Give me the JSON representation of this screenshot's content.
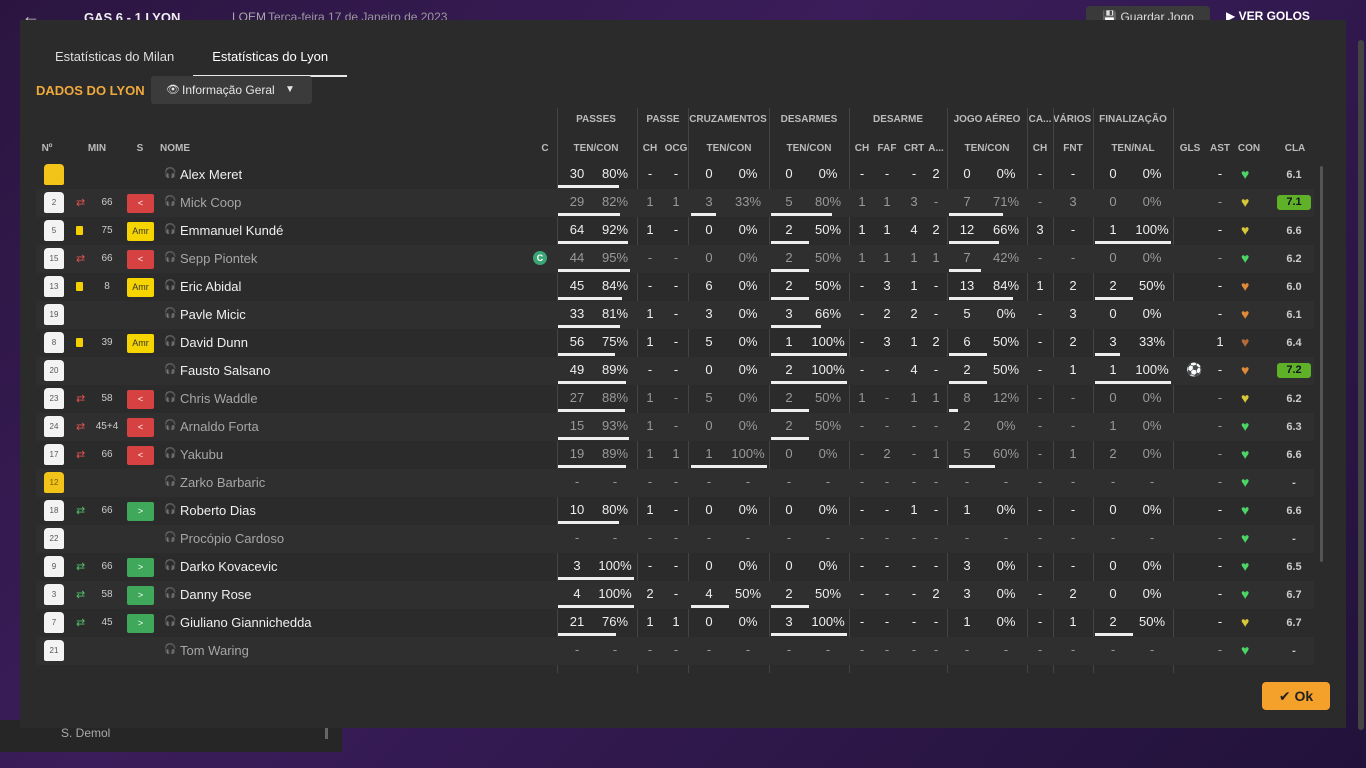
{
  "background": {
    "back_icon": "arrow-left-icon",
    "match_title": "GAS   6 - 1  LYON",
    "competition": "LOEM",
    "date": "Terça-feira 17 de Janeiro de 2023",
    "save_label": "Guardar Jogo",
    "play_label": "VER GOLOS",
    "bottom_player": "S. Demol"
  },
  "tabs": [
    {
      "label": "Estatísticas do Milan",
      "active": false
    },
    {
      "label": "Estatísticas do Lyon",
      "active": true
    }
  ],
  "section_title": "DADOS DO LYON",
  "view_selector": {
    "label": "Informação Geral",
    "icon": "eye-icon"
  },
  "group_headers": {
    "passes": "PASSES",
    "passe": "PASSE",
    "cruzamentos": "CRUZAMENTOS",
    "desarmes": "DESARMES",
    "desarme": "DESARME",
    "jogo_aereo": "JOGO AÉREO",
    "ca": "CA...",
    "varios": "VÁRIOS",
    "finalizacao": "FINALIZAÇÃO"
  },
  "columns": {
    "no": "Nº",
    "min": "MIN",
    "s": "S",
    "nome": "NOME",
    "c": "C",
    "passes_tc": "TEN/CON",
    "passe_ch": "CH",
    "passe_ocg": "OCG",
    "cruz_tc": "TEN/CON",
    "des_tc": "TEN/CON",
    "des_ch": "CH",
    "des_faf": "FAF",
    "des_crt": "CRT",
    "des_a": "A...",
    "aereo_tc": "TEN/CON",
    "ca_ch": "CH",
    "varios_fnt": "FNT",
    "fin_tn": "TEN/NAL",
    "gls": "GLS",
    "ast": "AST",
    "con": "CON",
    "cla": "CLA"
  },
  "players": [
    {
      "no": "",
      "gk": true,
      "sub": "",
      "min": "",
      "badge": "",
      "name": "Alex Meret",
      "dim": false,
      "captain": false,
      "pt": "30",
      "pp": "80%",
      "pbar": 80,
      "pch": "-",
      "pocg": "-",
      "ct": "0",
      "cp": "0%",
      "cbar": 0,
      "dt": "0",
      "dp": "0%",
      "dbar": 0,
      "dch": "-",
      "dfaf": "-",
      "dcrt": "-",
      "da": "2",
      "at": "0",
      "ap": "0%",
      "abar": 0,
      "cach": "-",
      "fnt": "-",
      "ft": "0",
      "fp": "0%",
      "fbar": 0,
      "gls": "",
      "ast": "-",
      "con": "green",
      "cla": "6.1",
      "best": false
    },
    {
      "no": "2",
      "gk": false,
      "sub": "out",
      "min": "66",
      "badge": "out",
      "name": "Mick Coop",
      "dim": true,
      "captain": false,
      "pt": "29",
      "pp": "82%",
      "pbar": 82,
      "pch": "1",
      "pocg": "1",
      "ct": "3",
      "cp": "33%",
      "cbar": 33,
      "dt": "5",
      "dp": "80%",
      "dbar": 80,
      "dch": "1",
      "dfaf": "1",
      "dcrt": "3",
      "da": "-",
      "at": "7",
      "ap": "71%",
      "abar": 71,
      "cach": "-",
      "fnt": "3",
      "ft": "0",
      "fp": "0%",
      "fbar": 0,
      "gls": "",
      "ast": "-",
      "con": "yellow",
      "cla": "7.1",
      "best": true
    },
    {
      "no": "5",
      "gk": false,
      "sub": "card",
      "min": "75",
      "badge": "amr",
      "name": "Emmanuel Kundé",
      "dim": false,
      "captain": false,
      "pt": "64",
      "pp": "92%",
      "pbar": 92,
      "pch": "1",
      "pocg": "-",
      "ct": "0",
      "cp": "0%",
      "cbar": 0,
      "dt": "2",
      "dp": "50%",
      "dbar": 50,
      "dch": "1",
      "dfaf": "1",
      "dcrt": "4",
      "da": "2",
      "at": "12",
      "ap": "66%",
      "abar": 66,
      "cach": "3",
      "fnt": "-",
      "ft": "1",
      "fp": "100%",
      "fbar": 100,
      "gls": "",
      "ast": "-",
      "con": "yellow",
      "cla": "6.6",
      "best": false
    },
    {
      "no": "15",
      "gk": false,
      "sub": "out",
      "min": "66",
      "badge": "out",
      "name": "Sepp Piontek",
      "dim": true,
      "captain": true,
      "pt": "44",
      "pp": "95%",
      "pbar": 95,
      "pch": "-",
      "pocg": "-",
      "ct": "0",
      "cp": "0%",
      "cbar": 0,
      "dt": "2",
      "dp": "50%",
      "dbar": 50,
      "dch": "1",
      "dfaf": "1",
      "dcrt": "1",
      "da": "1",
      "at": "7",
      "ap": "42%",
      "abar": 42,
      "cach": "-",
      "fnt": "-",
      "ft": "0",
      "fp": "0%",
      "fbar": 0,
      "gls": "",
      "ast": "-",
      "con": "green",
      "cla": "6.2",
      "best": false
    },
    {
      "no": "13",
      "gk": false,
      "sub": "card",
      "min": "8",
      "badge": "amr",
      "name": "Eric Abidal",
      "dim": false,
      "captain": false,
      "pt": "45",
      "pp": "84%",
      "pbar": 84,
      "pch": "-",
      "pocg": "-",
      "ct": "6",
      "cp": "0%",
      "cbar": 0,
      "dt": "2",
      "dp": "50%",
      "dbar": 50,
      "dch": "-",
      "dfaf": "3",
      "dcrt": "1",
      "da": "-",
      "at": "13",
      "ap": "84%",
      "abar": 84,
      "cach": "1",
      "fnt": "2",
      "ft": "2",
      "fp": "50%",
      "fbar": 50,
      "gls": "",
      "ast": "-",
      "con": "orange",
      "cla": "6.0",
      "best": false
    },
    {
      "no": "19",
      "gk": false,
      "sub": "",
      "min": "",
      "badge": "",
      "name": "Pavle Micic",
      "dim": false,
      "captain": false,
      "pt": "33",
      "pp": "81%",
      "pbar": 81,
      "pch": "1",
      "pocg": "-",
      "ct": "3",
      "cp": "0%",
      "cbar": 0,
      "dt": "3",
      "dp": "66%",
      "dbar": 66,
      "dch": "-",
      "dfaf": "2",
      "dcrt": "2",
      "da": "-",
      "at": "5",
      "ap": "0%",
      "abar": 0,
      "cach": "-",
      "fnt": "3",
      "ft": "0",
      "fp": "0%",
      "fbar": 0,
      "gls": "",
      "ast": "-",
      "con": "orange",
      "cla": "6.1",
      "best": false
    },
    {
      "no": "8",
      "gk": false,
      "sub": "card",
      "min": "39",
      "badge": "amr",
      "name": "David Dunn",
      "dim": false,
      "captain": false,
      "pt": "56",
      "pp": "75%",
      "pbar": 75,
      "pch": "1",
      "pocg": "-",
      "ct": "5",
      "cp": "0%",
      "cbar": 0,
      "dt": "1",
      "dp": "100%",
      "dbar": 100,
      "dch": "-",
      "dfaf": "3",
      "dcrt": "1",
      "da": "2",
      "at": "6",
      "ap": "50%",
      "abar": 50,
      "cach": "-",
      "fnt": "2",
      "ft": "3",
      "fp": "33%",
      "fbar": 33,
      "gls": "",
      "ast": "1",
      "con": "brown",
      "cla": "6.4",
      "best": false
    },
    {
      "no": "20",
      "gk": false,
      "sub": "",
      "min": "",
      "badge": "",
      "name": "Fausto Salsano",
      "dim": false,
      "captain": false,
      "pt": "49",
      "pp": "89%",
      "pbar": 89,
      "pch": "-",
      "pocg": "-",
      "ct": "0",
      "cp": "0%",
      "cbar": 0,
      "dt": "2",
      "dp": "100%",
      "dbar": 100,
      "dch": "-",
      "dfaf": "-",
      "dcrt": "4",
      "da": "-",
      "at": "2",
      "ap": "50%",
      "abar": 50,
      "cach": "-",
      "fnt": "1",
      "ft": "1",
      "fp": "100%",
      "fbar": 100,
      "gls": "ball",
      "ast": "-",
      "con": "orange",
      "cla": "7.2",
      "best": true
    },
    {
      "no": "23",
      "gk": false,
      "sub": "out",
      "min": "58",
      "badge": "out",
      "name": "Chris Waddle",
      "dim": true,
      "captain": false,
      "pt": "27",
      "pp": "88%",
      "pbar": 88,
      "pch": "1",
      "pocg": "-",
      "ct": "5",
      "cp": "0%",
      "cbar": 0,
      "dt": "2",
      "dp": "50%",
      "dbar": 50,
      "dch": "1",
      "dfaf": "-",
      "dcrt": "1",
      "da": "1",
      "at": "8",
      "ap": "12%",
      "abar": 12,
      "cach": "-",
      "fnt": "-",
      "ft": "0",
      "fp": "0%",
      "fbar": 0,
      "gls": "",
      "ast": "-",
      "con": "yellow",
      "cla": "6.2",
      "best": false
    },
    {
      "no": "24",
      "gk": false,
      "sub": "out",
      "min": "45+4",
      "badge": "out",
      "name": "Arnaldo Forta",
      "dim": true,
      "captain": false,
      "pt": "15",
      "pp": "93%",
      "pbar": 93,
      "pch": "1",
      "pocg": "-",
      "ct": "0",
      "cp": "0%",
      "cbar": 0,
      "dt": "2",
      "dp": "50%",
      "dbar": 50,
      "dch": "-",
      "dfaf": "-",
      "dcrt": "-",
      "da": "-",
      "at": "2",
      "ap": "0%",
      "abar": 0,
      "cach": "-",
      "fnt": "-",
      "ft": "1",
      "fp": "0%",
      "fbar": 0,
      "gls": "",
      "ast": "-",
      "con": "green",
      "cla": "6.3",
      "best": false
    },
    {
      "no": "17",
      "gk": false,
      "sub": "out",
      "min": "66",
      "badge": "out",
      "name": "Yakubu",
      "dim": true,
      "captain": false,
      "pt": "19",
      "pp": "89%",
      "pbar": 89,
      "pch": "1",
      "pocg": "1",
      "ct": "1",
      "cp": "100%",
      "cbar": 100,
      "dt": "0",
      "dp": "0%",
      "dbar": 0,
      "dch": "-",
      "dfaf": "2",
      "dcrt": "-",
      "da": "1",
      "at": "5",
      "ap": "60%",
      "abar": 60,
      "cach": "-",
      "fnt": "1",
      "ft": "2",
      "fp": "0%",
      "fbar": 0,
      "gls": "",
      "ast": "-",
      "con": "green",
      "cla": "6.6",
      "best": false
    },
    {
      "no": "12",
      "gk": true,
      "sub": "",
      "min": "",
      "badge": "",
      "name": "Zarko Barbaric",
      "dim": true,
      "captain": false,
      "pt": "-",
      "pp": "-",
      "pbar": 0,
      "pch": "-",
      "pocg": "-",
      "ct": "-",
      "cp": "-",
      "cbar": 0,
      "dt": "-",
      "dp": "-",
      "dbar": 0,
      "dch": "-",
      "dfaf": "-",
      "dcrt": "-",
      "da": "-",
      "at": "-",
      "ap": "-",
      "abar": 0,
      "cach": "-",
      "fnt": "-",
      "ft": "-",
      "fp": "-",
      "fbar": 0,
      "gls": "",
      "ast": "-",
      "con": "green",
      "cla": "-",
      "best": false
    },
    {
      "no": "18",
      "gk": false,
      "sub": "in",
      "min": "66",
      "badge": "in",
      "name": "Roberto Dias",
      "dim": false,
      "captain": false,
      "pt": "10",
      "pp": "80%",
      "pbar": 80,
      "pch": "1",
      "pocg": "-",
      "ct": "0",
      "cp": "0%",
      "cbar": 0,
      "dt": "0",
      "dp": "0%",
      "dbar": 0,
      "dch": "-",
      "dfaf": "-",
      "dcrt": "1",
      "da": "-",
      "at": "1",
      "ap": "0%",
      "abar": 0,
      "cach": "-",
      "fnt": "-",
      "ft": "0",
      "fp": "0%",
      "fbar": 0,
      "gls": "",
      "ast": "-",
      "con": "green",
      "cla": "6.6",
      "best": false
    },
    {
      "no": "22",
      "gk": false,
      "sub": "",
      "min": "",
      "badge": "",
      "name": "Procópio Cardoso",
      "dim": true,
      "captain": false,
      "pt": "-",
      "pp": "-",
      "pbar": 0,
      "pch": "-",
      "pocg": "-",
      "ct": "-",
      "cp": "-",
      "cbar": 0,
      "dt": "-",
      "dp": "-",
      "dbar": 0,
      "dch": "-",
      "dfaf": "-",
      "dcrt": "-",
      "da": "-",
      "at": "-",
      "ap": "-",
      "abar": 0,
      "cach": "-",
      "fnt": "-",
      "ft": "-",
      "fp": "-",
      "fbar": 0,
      "gls": "",
      "ast": "-",
      "con": "green",
      "cla": "-",
      "best": false
    },
    {
      "no": "9",
      "gk": false,
      "sub": "in",
      "min": "66",
      "badge": "in",
      "name": "Darko Kovacevic",
      "dim": false,
      "captain": false,
      "pt": "3",
      "pp": "100%",
      "pbar": 100,
      "pch": "-",
      "pocg": "-",
      "ct": "0",
      "cp": "0%",
      "cbar": 0,
      "dt": "0",
      "dp": "0%",
      "dbar": 0,
      "dch": "-",
      "dfaf": "-",
      "dcrt": "-",
      "da": "-",
      "at": "3",
      "ap": "0%",
      "abar": 0,
      "cach": "-",
      "fnt": "-",
      "ft": "0",
      "fp": "0%",
      "fbar": 0,
      "gls": "",
      "ast": "-",
      "con": "green",
      "cla": "6.5",
      "best": false
    },
    {
      "no": "3",
      "gk": false,
      "sub": "in",
      "min": "58",
      "badge": "in",
      "name": "Danny Rose",
      "dim": false,
      "captain": false,
      "pt": "4",
      "pp": "100%",
      "pbar": 100,
      "pch": "2",
      "pocg": "-",
      "ct": "4",
      "cp": "50%",
      "cbar": 50,
      "dt": "2",
      "dp": "50%",
      "dbar": 50,
      "dch": "-",
      "dfaf": "-",
      "dcrt": "-",
      "da": "2",
      "at": "3",
      "ap": "0%",
      "abar": 0,
      "cach": "-",
      "fnt": "2",
      "ft": "0",
      "fp": "0%",
      "fbar": 0,
      "gls": "",
      "ast": "-",
      "con": "green",
      "cla": "6.7",
      "best": false
    },
    {
      "no": "7",
      "gk": false,
      "sub": "in",
      "min": "45",
      "badge": "in",
      "name": "Giuliano Giannichedda",
      "dim": false,
      "captain": false,
      "pt": "21",
      "pp": "76%",
      "pbar": 76,
      "pch": "1",
      "pocg": "1",
      "ct": "0",
      "cp": "0%",
      "cbar": 0,
      "dt": "3",
      "dp": "100%",
      "dbar": 100,
      "dch": "-",
      "dfaf": "-",
      "dcrt": "-",
      "da": "-",
      "at": "1",
      "ap": "0%",
      "abar": 0,
      "cach": "-",
      "fnt": "1",
      "ft": "2",
      "fp": "50%",
      "fbar": 50,
      "gls": "",
      "ast": "-",
      "con": "yellow",
      "cla": "6.7",
      "best": false
    },
    {
      "no": "21",
      "gk": false,
      "sub": "",
      "min": "",
      "badge": "",
      "name": "Tom Waring",
      "dim": true,
      "captain": false,
      "pt": "-",
      "pp": "-",
      "pbar": 0,
      "pch": "-",
      "pocg": "-",
      "ct": "-",
      "cp": "-",
      "cbar": 0,
      "dt": "-",
      "dp": "-",
      "dbar": 0,
      "dch": "-",
      "dfaf": "-",
      "dcrt": "-",
      "da": "-",
      "at": "-",
      "ap": "-",
      "abar": 0,
      "cach": "-",
      "fnt": "-",
      "ft": "-",
      "fp": "-",
      "fbar": 0,
      "gls": "",
      "ast": "-",
      "con": "green",
      "cla": "-",
      "best": false
    }
  ],
  "ok_label": "Ok",
  "colors": {
    "accent": "#f0a93b",
    "best_rating": "#5fb228",
    "sub_out": "#d64242",
    "sub_in": "#3fa85a",
    "amr": "#f5d400"
  }
}
